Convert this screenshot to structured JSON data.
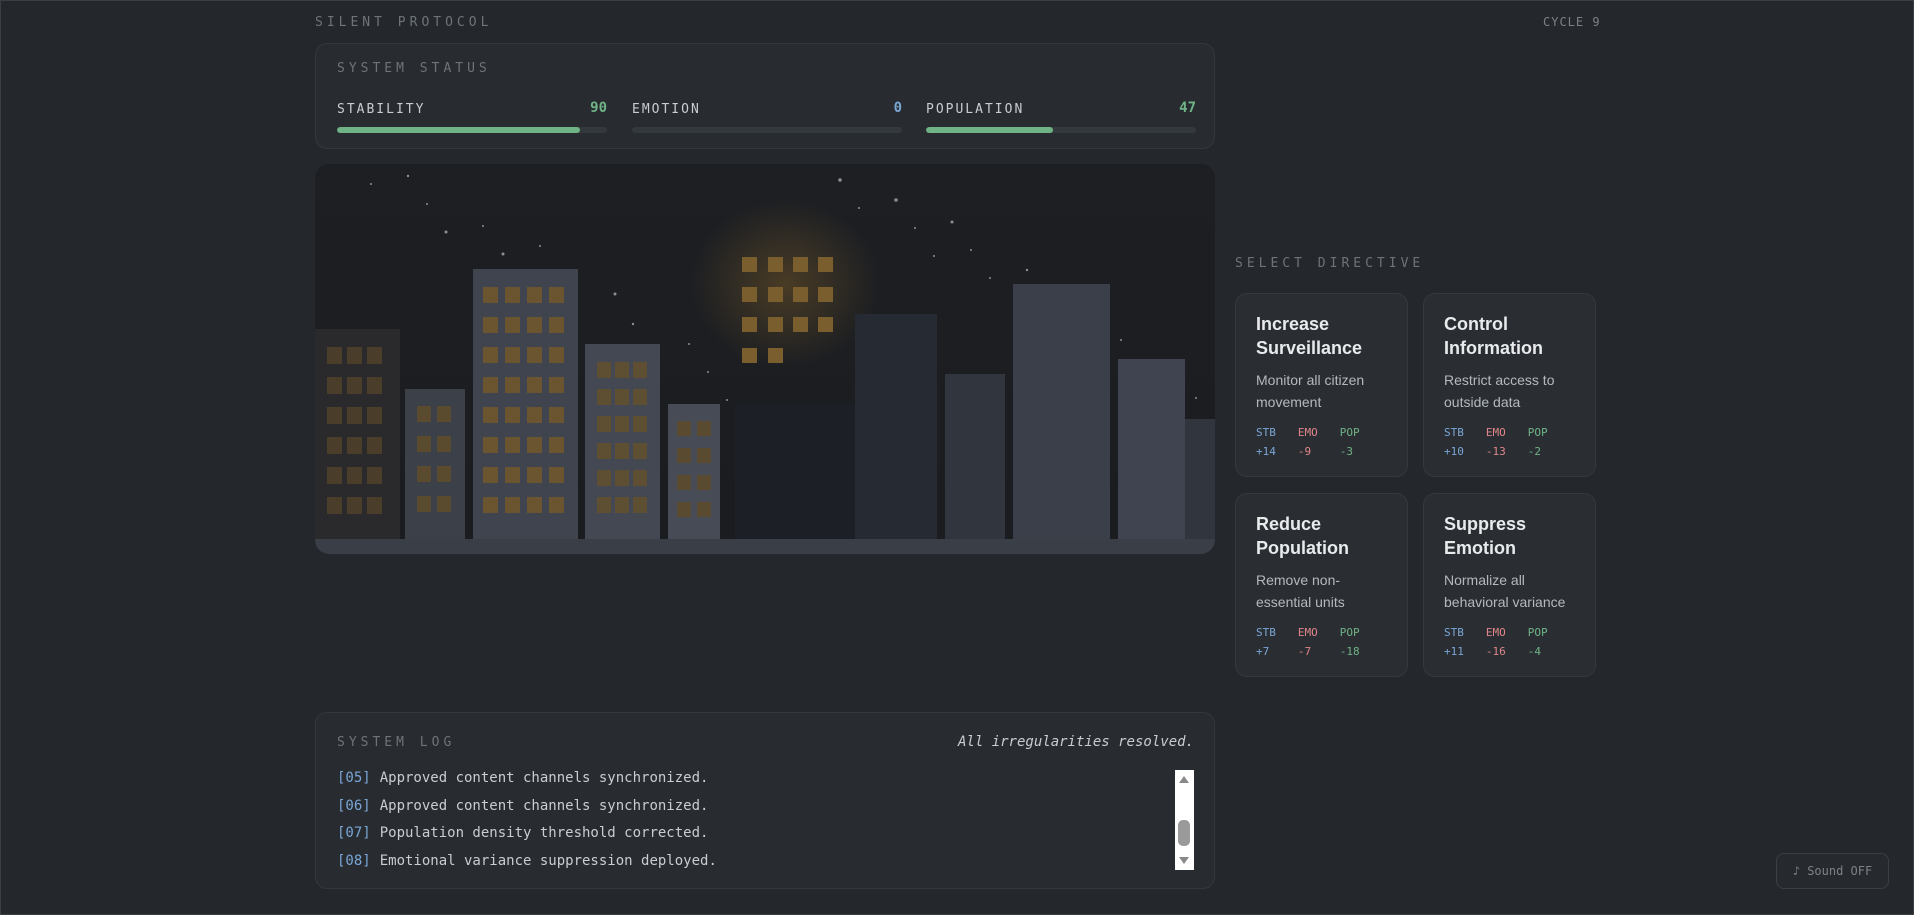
{
  "app": {
    "title": "SILENT PROTOCOL",
    "cycle": "CYCLE 9"
  },
  "status": {
    "label": "SYSTEM STATUS",
    "stats": [
      {
        "name": "STABILITY",
        "value": "90",
        "level": 0.9,
        "color": "#6fb386"
      },
      {
        "name": "EMOTION",
        "value": "0",
        "level": 0.0,
        "color": "#7aa6d6"
      },
      {
        "name": "POPULATION",
        "value": "47",
        "level": 0.47,
        "color": "#6fb386"
      }
    ]
  },
  "directives": {
    "label": "SELECT DIRECTIVE",
    "cards": [
      {
        "title": "Increase Surveillance",
        "desc": "Monitor all citizen movement",
        "effects": [
          {
            "k": "STB",
            "v": "+14"
          },
          {
            "k": "EMO",
            "v": "-9"
          },
          {
            "k": "POP",
            "v": "-3"
          }
        ]
      },
      {
        "title": "Control Information",
        "desc": "Restrict access to outside data",
        "effects": [
          {
            "k": "STB",
            "v": "+10"
          },
          {
            "k": "EMO",
            "v": "-13"
          },
          {
            "k": "POP",
            "v": "-2"
          }
        ]
      },
      {
        "title": "Reduce Population",
        "desc": "Remove non-essential units",
        "effects": [
          {
            "k": "STB",
            "v": "+7"
          },
          {
            "k": "EMO",
            "v": "-7"
          },
          {
            "k": "POP",
            "v": "-18"
          }
        ]
      },
      {
        "title": "Suppress Emotion",
        "desc": "Normalize all behavioral variance",
        "effects": [
          {
            "k": "STB",
            "v": "+11"
          },
          {
            "k": "EMO",
            "v": "-16"
          },
          {
            "k": "POP",
            "v": "-4"
          }
        ]
      }
    ],
    "effect_colors": {
      "STB": "#7aa6d6",
      "EMO": "#e0868a",
      "POP": "#6fb386"
    }
  },
  "log": {
    "label": "SYSTEM LOG",
    "status": "All irregularities resolved.",
    "entries": [
      {
        "num": "[05]",
        "text": "Approved content channels synchronized."
      },
      {
        "num": "[06]",
        "text": "Approved content channels synchronized."
      },
      {
        "num": "[07]",
        "text": "Population density threshold corrected."
      },
      {
        "num": "[08]",
        "text": "Emotional variance suppression deployed."
      }
    ]
  },
  "sound": {
    "label": "♪ Sound OFF"
  },
  "colors": {
    "background": "#24282c",
    "panel": "#282c30",
    "accent_green": "#6fb386",
    "accent_blue": "#7aa6d6",
    "accent_red": "#e0868a",
    "window_glow": "#a07a3c"
  }
}
